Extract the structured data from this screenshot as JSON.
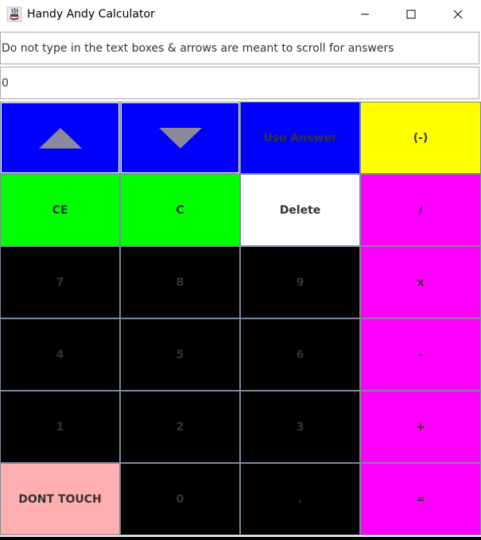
{
  "window": {
    "title": "Handy Andy Calculator",
    "icon": "java-cup-icon",
    "controls": [
      "minimize-icon",
      "maximize-icon",
      "close-icon"
    ]
  },
  "fields": {
    "instructions": "Do not type in the text boxes & arrows are meant to scroll for answers",
    "display": "0"
  },
  "keys": {
    "scroll_up": "",
    "scroll_down": "",
    "use_answer": "Use Answer",
    "negate": "(-)",
    "ce": "CE",
    "c": "C",
    "delete": "Delete",
    "divide": "/",
    "seven": "7",
    "eight": "8",
    "nine": "9",
    "multiply": "x",
    "four": "4",
    "five": "5",
    "six": "6",
    "minus": "-",
    "one": "1",
    "two": "2",
    "three": "3",
    "plus": "+",
    "dont_touch": "DONT TOUCH",
    "zero": "0",
    "decimal": ".",
    "equals": "="
  },
  "colors": {
    "scroll_keys": "#0000ff",
    "use_answer": "#0000ff",
    "negate": "#ffff00",
    "clear_keys": "#00ff00",
    "delete": "#ffffff",
    "operators": "#ff00ff",
    "digits": "#000000",
    "dont_touch": "#ffafaf",
    "arrow": "#8a8a9a"
  }
}
